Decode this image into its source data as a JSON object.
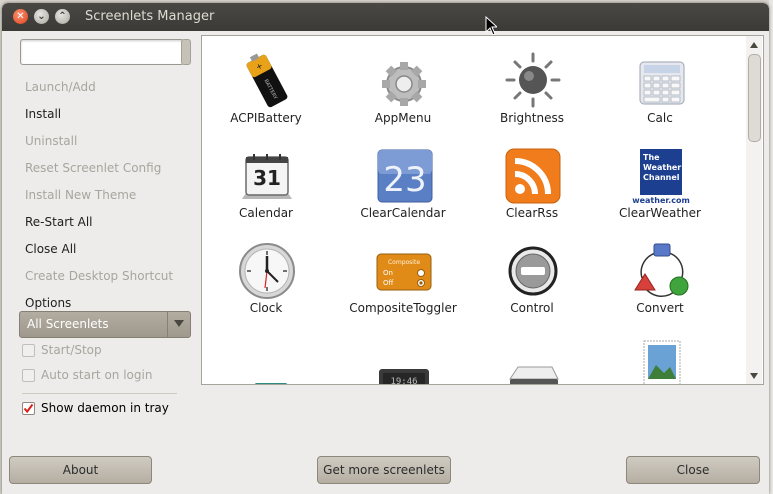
{
  "window": {
    "title": "Screenlets Manager"
  },
  "search": {
    "value": "",
    "placeholder": ""
  },
  "menu": [
    {
      "label": "Launch/Add",
      "enabled": false
    },
    {
      "label": "Install",
      "enabled": true
    },
    {
      "label": "Uninstall",
      "enabled": false
    },
    {
      "label": "Reset Screenlet Config",
      "enabled": false
    },
    {
      "label": "Install New Theme",
      "enabled": false
    },
    {
      "label": "Re-Start All",
      "enabled": true
    },
    {
      "label": "Close All",
      "enabled": true
    },
    {
      "label": "Create Desktop Shortcut",
      "enabled": false
    },
    {
      "label": "Options",
      "enabled": true
    }
  ],
  "filter": {
    "selected": "All Screenlets"
  },
  "checks": [
    {
      "label": "Start/Stop",
      "checked": false,
      "enabled": false
    },
    {
      "label": "Auto start on login",
      "checked": false,
      "enabled": false
    },
    {
      "label": "Show daemon in tray",
      "checked": true,
      "enabled": true
    }
  ],
  "screenlets": [
    {
      "name": "ACPIBattery",
      "icon": "battery-icon"
    },
    {
      "name": "AppMenu",
      "icon": "gear-icon"
    },
    {
      "name": "Brightness",
      "icon": "sun-icon"
    },
    {
      "name": "Calc",
      "icon": "calculator-icon"
    },
    {
      "name": "Calendar",
      "icon": "calendar-icon",
      "day": "31"
    },
    {
      "name": "ClearCalendar",
      "icon": "clear-calendar-icon",
      "day": "23"
    },
    {
      "name": "ClearRss",
      "icon": "rss-icon"
    },
    {
      "name": "ClearWeather",
      "icon": "weather-channel-icon",
      "brand": [
        "The",
        "Weather",
        "Channel",
        "weather.com"
      ]
    },
    {
      "name": "Clock",
      "icon": "clock-icon"
    },
    {
      "name": "CompositeToggler",
      "icon": "composite-toggler-icon",
      "text": [
        "Composite",
        "On",
        "Off"
      ]
    },
    {
      "name": "Control",
      "icon": "control-icon"
    },
    {
      "name": "Convert",
      "icon": "convert-icon"
    }
  ],
  "buttons": {
    "about": "About",
    "more": "Get more screenlets",
    "close": "Close"
  },
  "colors": {
    "titlebar": "#3b3a36",
    "close_button": "#e2431b",
    "rss": "#f07c1b",
    "clear_calendar": "#5b7fc4",
    "weather": "#1d3f8f"
  }
}
